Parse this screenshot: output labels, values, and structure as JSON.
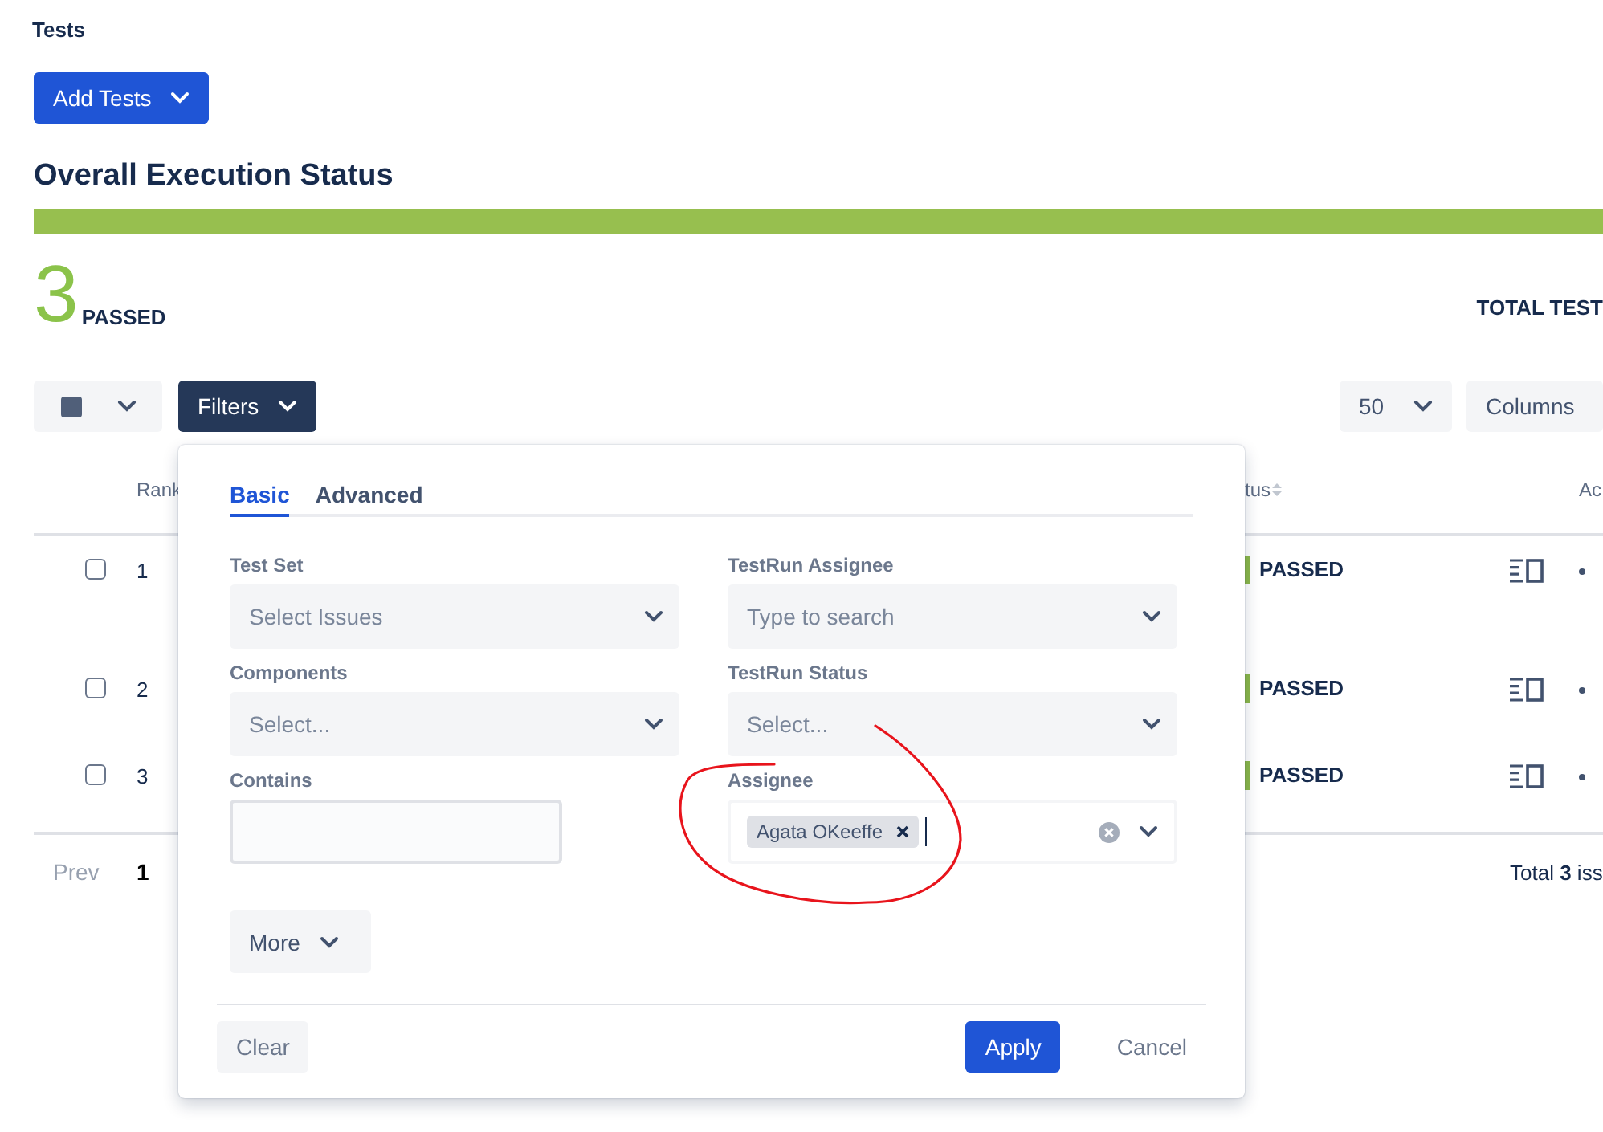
{
  "page_title": "Tests",
  "add_button": {
    "label": "Add Tests"
  },
  "execution_status": {
    "title": "Overall Execution Status",
    "level": 1,
    "count": "3",
    "count_label": "PASSED",
    "total_label": "TOTAL TEST"
  },
  "toolbar": {
    "filters_button": "Filters",
    "page_size": "50",
    "columns_button": "Columns"
  },
  "table": {
    "columns": [
      {
        "label": "Rank"
      },
      {
        "label": "tus",
        "sortable": true
      },
      {
        "label": "Ac"
      }
    ],
    "rows": [
      {
        "checked": false,
        "rank": "1",
        "status": "PASSED",
        "color": "#8bb84a"
      },
      {
        "checked": false,
        "rank": "2",
        "status": "PASSED",
        "color": "#8bb84a"
      },
      {
        "checked": false,
        "rank": "3",
        "status": "PASSED",
        "color": "#8bb84a"
      }
    ]
  },
  "pagination": {
    "prev": "Prev",
    "pages": [
      {
        "label": "1",
        "selected": true
      }
    ],
    "total_prefix": "Total ",
    "total_count": "3",
    "total_suffix": " iss"
  },
  "filter_panel": {
    "tabs": [
      {
        "label": "Basic",
        "selected": true
      },
      {
        "label": "Advanced",
        "selected": false
      }
    ],
    "fields": [
      {
        "kind": "select",
        "label": "Test Set",
        "placeholder": "Select Issues"
      },
      {
        "kind": "select",
        "label": "TestRun Assignee",
        "placeholder": "Type to search"
      },
      {
        "kind": "select",
        "label": "Components",
        "placeholder": "Select..."
      },
      {
        "kind": "select",
        "label": "TestRun Status",
        "placeholder": "Select..."
      },
      {
        "kind": "text",
        "label": "Contains"
      },
      {
        "kind": "multi",
        "label": "Assignee",
        "tags": [
          "Agata OKeeffe"
        ],
        "focused": true
      }
    ],
    "more_button": "More",
    "clear_button": "Clear",
    "apply_button": "Apply",
    "cancel_button": "Cancel"
  }
}
